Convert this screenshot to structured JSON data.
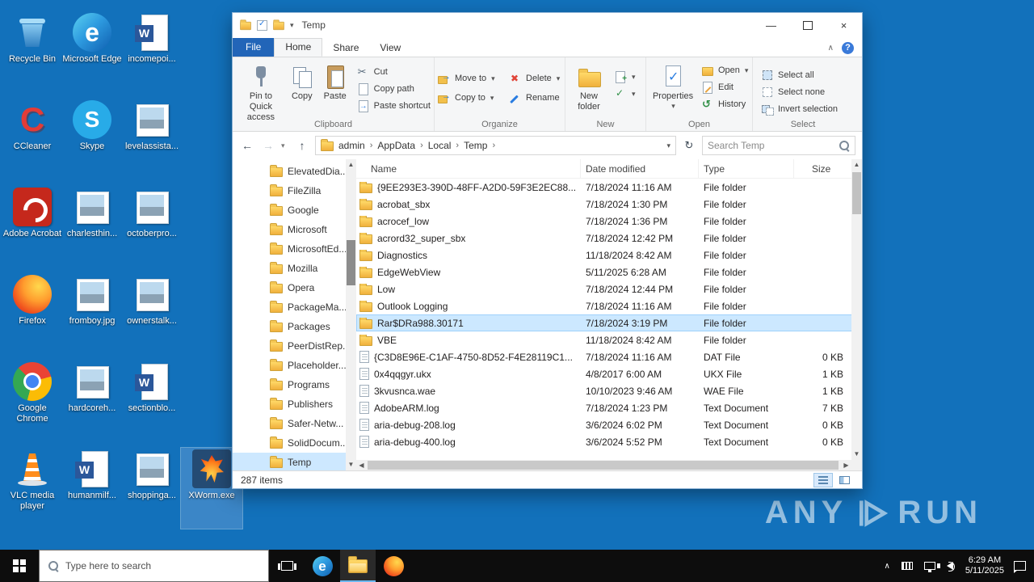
{
  "desktop": {
    "icons": [
      {
        "label": "Recycle Bin",
        "kind": "recycle",
        "col": 0,
        "row": 0
      },
      {
        "label": "CCleaner",
        "kind": "ccleaner",
        "col": 0,
        "row": 1
      },
      {
        "label": "Adobe Acrobat",
        "kind": "acrobat",
        "col": 0,
        "row": 2
      },
      {
        "label": "Firefox",
        "kind": "firefox",
        "col": 0,
        "row": 3
      },
      {
        "label": "Google Chrome",
        "kind": "chrome",
        "col": 0,
        "row": 4
      },
      {
        "label": "VLC media player",
        "kind": "vlc",
        "col": 0,
        "row": 5
      },
      {
        "label": "Microsoft Edge",
        "kind": "edge",
        "col": 1,
        "row": 0
      },
      {
        "label": "Skype",
        "kind": "skype",
        "col": 1,
        "row": 1
      },
      {
        "label": "charlesthin...",
        "kind": "image",
        "col": 1,
        "row": 2
      },
      {
        "label": "fromboy.jpg",
        "kind": "image",
        "col": 1,
        "row": 3
      },
      {
        "label": "hardcoreh...",
        "kind": "image",
        "col": 1,
        "row": 4
      },
      {
        "label": "humanmilf...",
        "kind": "word",
        "col": 1,
        "row": 5
      },
      {
        "label": "incomepoi...",
        "kind": "word",
        "col": 2,
        "row": 0
      },
      {
        "label": "levelassista...",
        "kind": "image",
        "col": 2,
        "row": 1
      },
      {
        "label": "octoberpro...",
        "kind": "image",
        "col": 2,
        "row": 2
      },
      {
        "label": "ownerstalk...",
        "kind": "image",
        "col": 2,
        "row": 3
      },
      {
        "label": "sectionblo...",
        "kind": "word",
        "col": 2,
        "row": 4
      },
      {
        "label": "shoppinga...",
        "kind": "image",
        "col": 2,
        "row": 5
      },
      {
        "label": "XWorm.exe",
        "kind": "xworm",
        "col": 3,
        "row": 5,
        "selected": true
      }
    ]
  },
  "window": {
    "title": "Temp",
    "controls": {
      "minimize": "—",
      "close": "×"
    },
    "tabs": {
      "file": "File",
      "home": "Home",
      "share": "Share",
      "view": "View"
    },
    "ribbon": {
      "clipboard": {
        "pin": "Pin to Quick access",
        "copy": "Copy",
        "paste": "Paste",
        "cut": "Cut",
        "copy_path": "Copy path",
        "paste_shortcut": "Paste shortcut",
        "label": "Clipboard"
      },
      "organize": {
        "move_to": "Move to",
        "copy_to": "Copy to",
        "delete": "Delete",
        "rename": "Rename",
        "label": "Organize"
      },
      "new_group": {
        "new_folder": "New folder",
        "label": "New"
      },
      "open_group": {
        "properties": "Properties",
        "open": "Open",
        "edit": "Edit",
        "history": "History",
        "label": "Open"
      },
      "select_group": {
        "select_all": "Select all",
        "select_none": "Select none",
        "invert": "Invert selection",
        "label": "Select"
      }
    },
    "address": {
      "crumbs": [
        "admin",
        "AppData",
        "Local",
        "Temp"
      ],
      "search_placeholder": "Search Temp"
    },
    "nav": {
      "items": [
        {
          "label": "ElevatedDia..."
        },
        {
          "label": "FileZilla"
        },
        {
          "label": "Google"
        },
        {
          "label": "Microsoft"
        },
        {
          "label": "MicrosoftEd..."
        },
        {
          "label": "Mozilla"
        },
        {
          "label": "Opera"
        },
        {
          "label": "PackageMa..."
        },
        {
          "label": "Packages"
        },
        {
          "label": "PeerDistRep..."
        },
        {
          "label": "Placeholder..."
        },
        {
          "label": "Programs"
        },
        {
          "label": "Publishers"
        },
        {
          "label": "Safer-Netw..."
        },
        {
          "label": "SolidDocum..."
        },
        {
          "label": "Temp",
          "selected": true
        }
      ]
    },
    "columns": {
      "name": "Name",
      "date": "Date modified",
      "type": "Type",
      "size": "Size"
    },
    "files": [
      {
        "name": "{9EE293E3-390D-48FF-A2D0-59F3E2EC88...",
        "date": "7/18/2024 11:16 AM",
        "type": "File folder",
        "size": "",
        "kind": "folder"
      },
      {
        "name": "acrobat_sbx",
        "date": "7/18/2024 1:30 PM",
        "type": "File folder",
        "size": "",
        "kind": "folder"
      },
      {
        "name": "acrocef_low",
        "date": "7/18/2024 1:36 PM",
        "type": "File folder",
        "size": "",
        "kind": "folder"
      },
      {
        "name": "acrord32_super_sbx",
        "date": "7/18/2024 12:42 PM",
        "type": "File folder",
        "size": "",
        "kind": "folder"
      },
      {
        "name": "Diagnostics",
        "date": "11/18/2024 8:42 AM",
        "type": "File folder",
        "size": "",
        "kind": "folder"
      },
      {
        "name": "EdgeWebView",
        "date": "5/11/2025 6:28 AM",
        "type": "File folder",
        "size": "",
        "kind": "folder"
      },
      {
        "name": "Low",
        "date": "7/18/2024 12:44 PM",
        "type": "File folder",
        "size": "",
        "kind": "folder"
      },
      {
        "name": "Outlook Logging",
        "date": "7/18/2024 11:16 AM",
        "type": "File folder",
        "size": "",
        "kind": "folder"
      },
      {
        "name": "Rar$DRa988.30171",
        "date": "7/18/2024 3:19 PM",
        "type": "File folder",
        "size": "",
        "kind": "folder",
        "selected": true
      },
      {
        "name": "VBE",
        "date": "11/18/2024 8:42 AM",
        "type": "File folder",
        "size": "",
        "kind": "folder"
      },
      {
        "name": "{C3D8E96E-C1AF-4750-8D52-F4E28119C1...",
        "date": "7/18/2024 11:16 AM",
        "type": "DAT File",
        "size": "0 KB",
        "kind": "file"
      },
      {
        "name": "0x4qqgyr.ukx",
        "date": "4/8/2017 6:00 AM",
        "type": "UKX File",
        "size": "1 KB",
        "kind": "file"
      },
      {
        "name": "3kvusnca.wae",
        "date": "10/10/2023 9:46 AM",
        "type": "WAE File",
        "size": "1 KB",
        "kind": "file"
      },
      {
        "name": "AdobeARM.log",
        "date": "7/18/2024 1:23 PM",
        "type": "Text Document",
        "size": "7 KB",
        "kind": "file"
      },
      {
        "name": "aria-debug-208.log",
        "date": "3/6/2024 6:02 PM",
        "type": "Text Document",
        "size": "0 KB",
        "kind": "file"
      },
      {
        "name": "aria-debug-400.log",
        "date": "3/6/2024 5:52 PM",
        "type": "Text Document",
        "size": "0 KB",
        "kind": "file"
      }
    ],
    "status": "287 items"
  },
  "taskbar": {
    "search_placeholder": "Type here to search",
    "time": "6:29 AM",
    "date": "5/11/2025"
  },
  "watermark": {
    "left": "ANY",
    "right": "RUN"
  }
}
